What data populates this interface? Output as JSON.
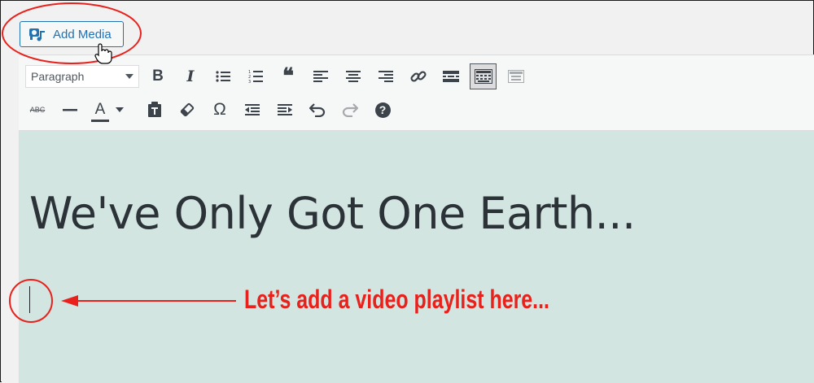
{
  "add_media": {
    "label": "Add Media"
  },
  "toolbar": {
    "format_select": {
      "value": "Paragraph"
    },
    "row1": [
      {
        "name": "bold",
        "glyph": "B"
      },
      {
        "name": "italic",
        "glyph": "I"
      },
      {
        "name": "bulleted-list"
      },
      {
        "name": "numbered-list"
      },
      {
        "name": "blockquote",
        "glyph": "❝"
      },
      {
        "name": "align-left"
      },
      {
        "name": "align-center"
      },
      {
        "name": "align-right"
      },
      {
        "name": "insert-link"
      },
      {
        "name": "read-more"
      },
      {
        "name": "toolbar-toggle"
      },
      {
        "name": "distraction-free"
      }
    ],
    "row2": [
      {
        "name": "strikethrough",
        "glyph": "ABC"
      },
      {
        "name": "horizontal-line"
      },
      {
        "name": "text-color",
        "glyph": "A"
      },
      {
        "name": "paste-as-text"
      },
      {
        "name": "clear-formatting"
      },
      {
        "name": "special-character",
        "glyph": "Ω"
      },
      {
        "name": "decrease-indent"
      },
      {
        "name": "increase-indent"
      },
      {
        "name": "undo"
      },
      {
        "name": "redo"
      },
      {
        "name": "keyboard-shortcuts",
        "glyph": "?"
      }
    ]
  },
  "content": {
    "heading": "We've Only Got One Earth..."
  },
  "annotation": {
    "text": "Let’s add a video playlist here...",
    "color": "#e8211c"
  },
  "colors": {
    "accent": "#2271b1",
    "content_bg": "#d3e5e0",
    "annotation_red": "#e8211c"
  }
}
